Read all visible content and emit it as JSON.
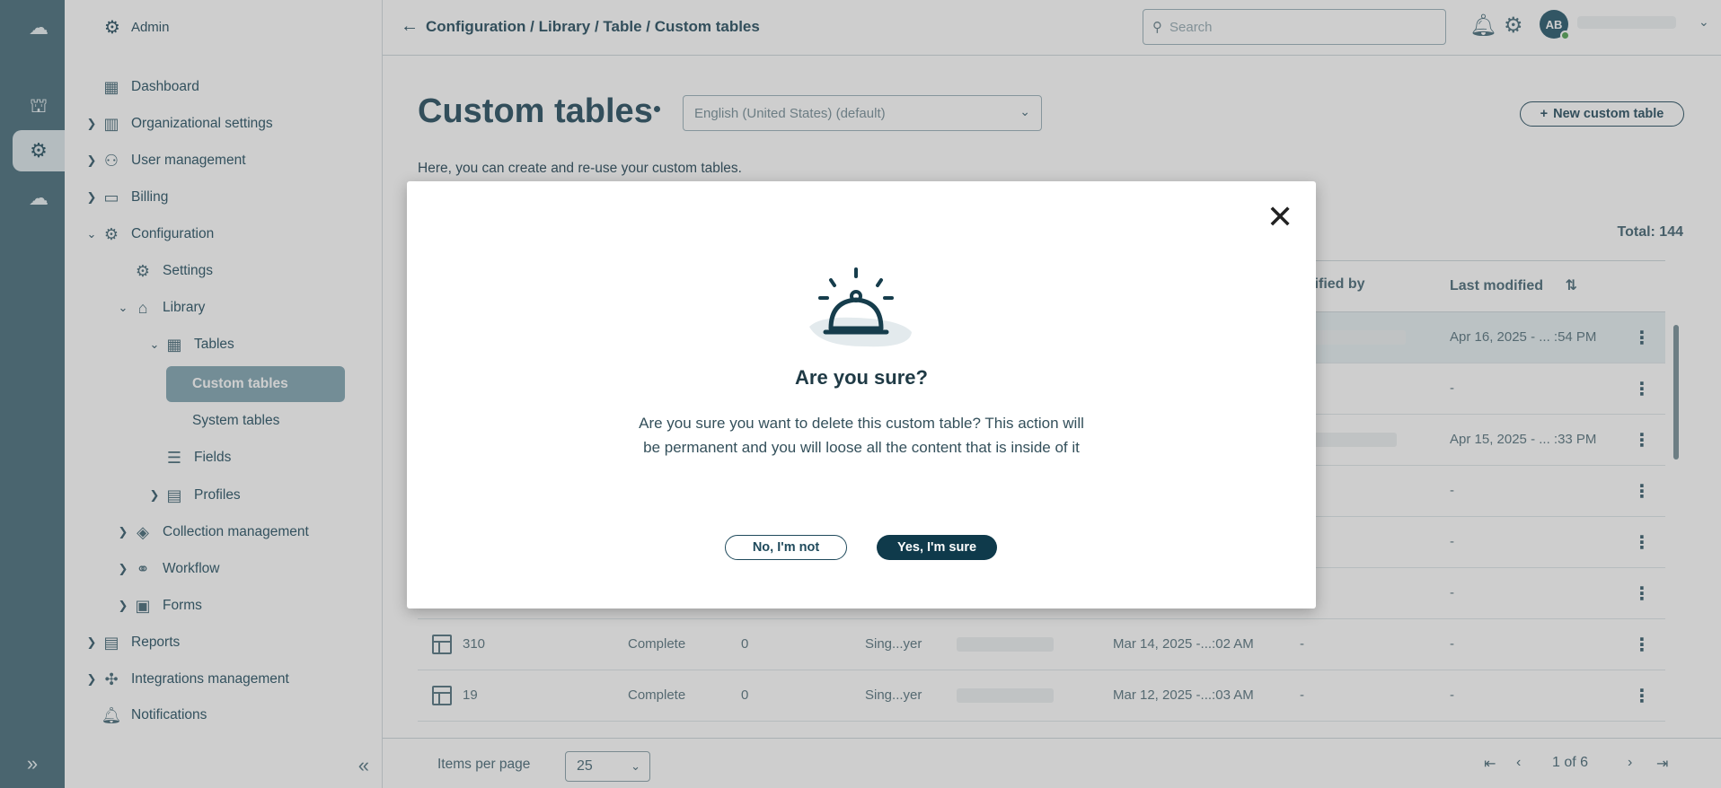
{
  "sidebar": {
    "header": "Admin",
    "items": [
      {
        "label": "Dashboard",
        "icon": "dashboard-icon"
      },
      {
        "label": "Organizational settings",
        "icon": "building-icon"
      },
      {
        "label": "User management",
        "icon": "user-gear-icon"
      },
      {
        "label": "Billing",
        "icon": "credit-card-icon"
      },
      {
        "label": "Configuration",
        "icon": "config-gear-icon"
      },
      {
        "label": "Settings",
        "icon": "settings-gear-icon"
      },
      {
        "label": "Library",
        "icon": "library-icon"
      },
      {
        "label": "Tables",
        "icon": "table-icon"
      },
      {
        "label": "Custom tables"
      },
      {
        "label": "System tables"
      },
      {
        "label": "Fields",
        "icon": "fields-icon"
      },
      {
        "label": "Profiles",
        "icon": "profiles-icon"
      },
      {
        "label": "Collection management",
        "icon": "layers-icon"
      },
      {
        "label": "Workflow",
        "icon": "workflow-icon"
      },
      {
        "label": "Forms",
        "icon": "forms-icon"
      },
      {
        "label": "Reports",
        "icon": "reports-icon"
      },
      {
        "label": "Integrations management",
        "icon": "puzzle-icon"
      },
      {
        "label": "Notifications",
        "icon": "bell-icon"
      }
    ]
  },
  "topbar": {
    "breadcrumb": "Configuration / Library / Table / Custom tables",
    "search_placeholder": "Search",
    "avatar_initials": "AB"
  },
  "page": {
    "title": "Custom tables",
    "language": "English (United States) (default)",
    "new_button": "New custom table",
    "description": "Here, you can create and re-use your custom tables.",
    "total": "Total: 144"
  },
  "table": {
    "headers": {
      "modified_by": "odified by",
      "last_modified": "Last modified"
    },
    "rows": [
      {
        "last_modified": "Apr 16, 2025 - ... :54 PM"
      },
      {
        "last_modified": "-"
      },
      {
        "last_modified": "Apr 15, 2025 - ... :33 PM"
      },
      {
        "last_modified": "-"
      },
      {
        "last_modified": "-"
      },
      {
        "last_modified": "-"
      },
      {
        "name": "310",
        "status": "Complete",
        "count": "0",
        "type": "Sing...yer",
        "created": "Mar 14, 2025 -...:02 AM",
        "modified_by": "-",
        "last_modified": "-"
      },
      {
        "name": "19",
        "status": "Complete",
        "count": "0",
        "type": "Sing...yer",
        "created": "Mar 12, 2025 -...:03 AM",
        "modified_by": "-",
        "last_modified": "-"
      }
    ]
  },
  "pager": {
    "items_per_page_label": "Items per page",
    "items_per_page": "25",
    "page_info": "1 of 6"
  },
  "modal": {
    "title": "Are you sure?",
    "message": "Are you sure you want to delete this custom table? This action will be permanent and you will loose all the content that is inside of it",
    "no_label": "No, I'm not",
    "yes_label": "Yes, I'm sure"
  },
  "colors": {
    "rail": "#4f7381",
    "primary": "#0f3a4b",
    "active_nav": "#86a8b5"
  }
}
